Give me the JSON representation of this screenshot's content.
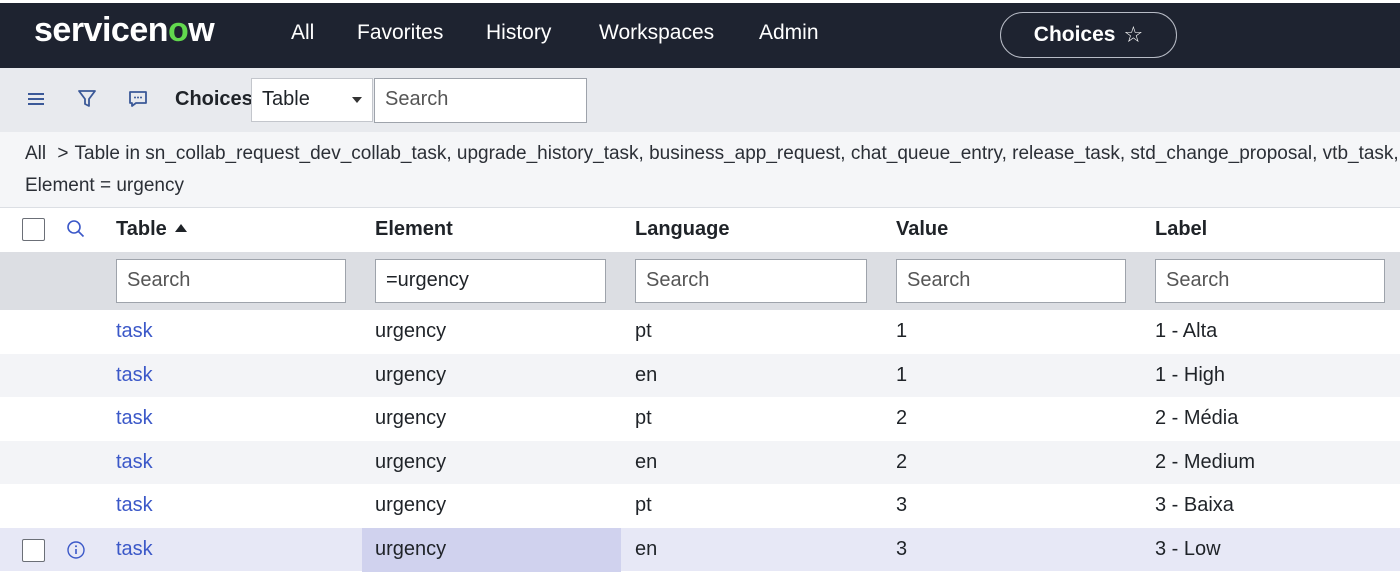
{
  "logo": {
    "text_before": "servicen",
    "text_o": "o",
    "text_after": "w"
  },
  "nav": {
    "items": [
      "All",
      "Favorites",
      "History",
      "Workspaces",
      "Admin"
    ],
    "current": "Choices"
  },
  "toolbar": {
    "title": "Choices",
    "select_value": "Table",
    "search_placeholder": "Search"
  },
  "breadcrumb": {
    "root": "All",
    "separator": ">",
    "condition1": "Table in sn_collab_request_dev_collab_task, upgrade_history_task, business_app_request, chat_queue_entry, release_task, std_change_proposal, vtb_task, k",
    "condition2": "Element = urgency"
  },
  "columns": [
    "Table",
    "Element",
    "Language",
    "Value",
    "Label"
  ],
  "filters": {
    "table": "",
    "element": "=urgency",
    "language": "",
    "value": "",
    "label": "",
    "placeholder": "Search"
  },
  "rows": [
    {
      "table": "task",
      "element": "urgency",
      "language": "pt",
      "value": "1",
      "label": "1 - Alta"
    },
    {
      "table": "task",
      "element": "urgency",
      "language": "en",
      "value": "1",
      "label": "1 - High"
    },
    {
      "table": "task",
      "element": "urgency",
      "language": "pt",
      "value": "2",
      "label": "2 - Média"
    },
    {
      "table": "task",
      "element": "urgency",
      "language": "en",
      "value": "2",
      "label": "2 - Medium"
    },
    {
      "table": "task",
      "element": "urgency",
      "language": "pt",
      "value": "3",
      "label": "3 - Baixa"
    },
    {
      "table": "task",
      "element": "urgency",
      "language": "en",
      "value": "3",
      "label": "3 - Low"
    }
  ],
  "colors": {
    "nav_bg": "#1e2330",
    "accent_green": "#62d84e",
    "link": "#3b58c8",
    "highlight_row": "#e7e8f6"
  }
}
